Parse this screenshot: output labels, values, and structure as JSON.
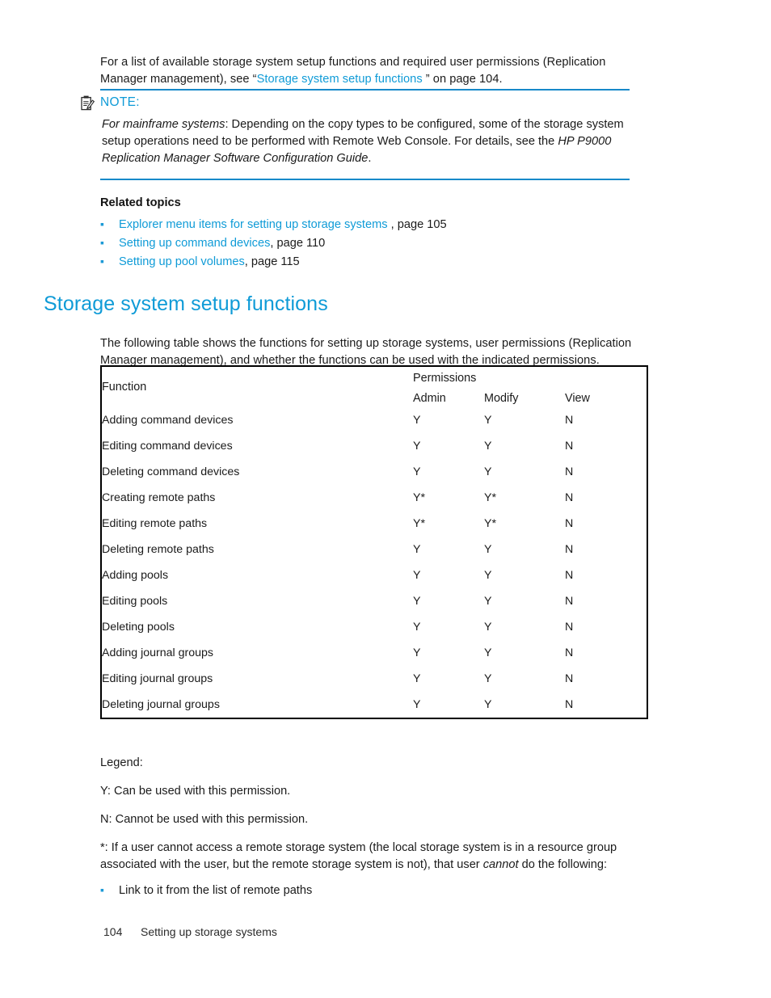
{
  "intro": {
    "text_before_link": "For a list of available storage system setup functions and required user permissions (Replication Manager management), see “",
    "link_text": "Storage system setup functions",
    "text_after_link": " ” on page 104."
  },
  "note": {
    "icon": "note-clipboard-icon",
    "title": "NOTE:",
    "lead_italic": "For mainframe systems",
    "body_part1": ": Depending on the copy types to be configured, some of the storage system setup operations need to be performed with Remote Web Console. For details, see the ",
    "body_italic2": "HP P9000 Replication Manager Software Configuration Guide",
    "body_part3": "."
  },
  "related": {
    "heading": "Related topics",
    "items": [
      {
        "link": "Explorer menu items for setting up storage systems",
        "suffix": " , page 105"
      },
      {
        "link": "Setting up command devices",
        "suffix": ", page 110"
      },
      {
        "link": "Setting up pool volumes",
        "suffix": ", page 115"
      }
    ]
  },
  "section": {
    "heading": "Storage system setup functions",
    "intro": "The following table shows the functions for setting up storage systems, user permissions (Replication Manager management), and whether the functions can be used with the indicated permissions."
  },
  "table": {
    "header_function": "Function",
    "header_group": "Permissions",
    "columns": [
      "Admin",
      "Modify",
      "View"
    ],
    "rows": [
      {
        "function": "Adding command devices",
        "admin": "Y",
        "modify": "Y",
        "view": "N"
      },
      {
        "function": "Editing command devices",
        "admin": "Y",
        "modify": "Y",
        "view": "N"
      },
      {
        "function": "Deleting command devices",
        "admin": "Y",
        "modify": "Y",
        "view": "N"
      },
      {
        "function": "Creating remote paths",
        "admin": "Y*",
        "modify": "Y*",
        "view": "N"
      },
      {
        "function": "Editing remote paths",
        "admin": "Y*",
        "modify": "Y*",
        "view": "N"
      },
      {
        "function": "Deleting remote paths",
        "admin": "Y",
        "modify": "Y",
        "view": "N"
      },
      {
        "function": "Adding pools",
        "admin": "Y",
        "modify": "Y",
        "view": "N"
      },
      {
        "function": "Editing pools",
        "admin": "Y",
        "modify": "Y",
        "view": "N"
      },
      {
        "function": "Deleting pools",
        "admin": "Y",
        "modify": "Y",
        "view": "N"
      },
      {
        "function": "Adding journal groups",
        "admin": "Y",
        "modify": "Y",
        "view": "N"
      },
      {
        "function": "Editing journal groups",
        "admin": "Y",
        "modify": "Y",
        "view": "N"
      },
      {
        "function": "Deleting journal groups",
        "admin": "Y",
        "modify": "Y",
        "view": "N"
      }
    ]
  },
  "legend": {
    "title": "Legend:",
    "y_line": "Y: Can be used with this permission.",
    "n_line": "N: Cannot be used with this permission.",
    "star_part1": "*: If a user cannot access a remote storage system (the local storage system is in a resource group associated with the user, but the remote storage system is not), that user ",
    "star_italic": "cannot",
    "star_part2": " do the following:",
    "bullet": "Link to it from the list of remote paths"
  },
  "footer": {
    "page_number": "104",
    "section_name": "Setting up storage systems"
  },
  "colors": {
    "accent_blue": "#0f9bd7",
    "rule_blue": "#1789c9",
    "text": "#1b1b1b",
    "table_border": "#000000",
    "table_grid": "#8a8a8a"
  }
}
